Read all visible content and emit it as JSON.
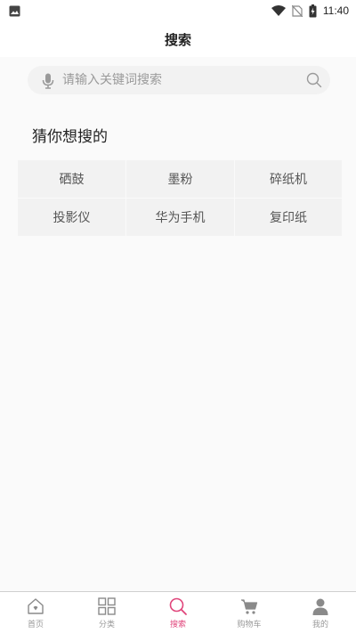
{
  "status_bar": {
    "time": "11:40",
    "icons": [
      "image-icon",
      "wifi-icon",
      "no-sim-icon",
      "battery-charging-icon"
    ]
  },
  "header": {
    "title": "搜索"
  },
  "search": {
    "placeholder": "请输入关键词搜索",
    "icons": [
      "microphone-icon",
      "search-icon"
    ]
  },
  "suggestions": {
    "title": "猜你想搜的",
    "items": [
      "硒鼓",
      "墨粉",
      "碎纸机",
      "投影仪",
      "华为手机",
      "复印纸"
    ]
  },
  "tab_bar": {
    "active_color": "#e0457b",
    "tabs": [
      {
        "label": "首页",
        "icon": "home-icon"
      },
      {
        "label": "分类",
        "icon": "grid-icon"
      },
      {
        "label": "搜索",
        "icon": "search-icon",
        "active": true
      },
      {
        "label": "购物车",
        "icon": "cart-icon"
      },
      {
        "label": "我的",
        "icon": "user-icon"
      }
    ]
  }
}
